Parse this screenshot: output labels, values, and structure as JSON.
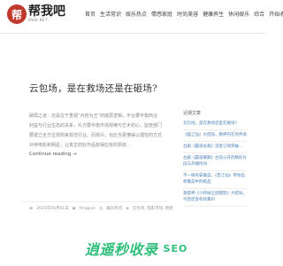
{
  "header": {
    "logo_mark": "帮",
    "logo_name": "帮我吧",
    "logo_domain": "BWB.NET",
    "nav": [
      "首页",
      "生活常识",
      "娱乐热点",
      "情感家庭",
      "时尚美容",
      "健康养生",
      "休闲娱乐",
      "综合",
      "开始收藏"
    ]
  },
  "post": {
    "title": "云包场，是在救场还是在砸场?",
    "excerpt": "破局之道：还是在于重视“内容为王”的底层逻辑，平台要平衡商业利益与行业生态的关系，片方要平衡市场规律与艺术初心，监管部门要建立全方位规则来规范行业。而观众，也应当更懂得以理性的方式对待电影和明星，让真正的好作品获得应有的票房…",
    "continue_label": "Continue reading →",
    "meta": {
      "date": "2025年06月01日",
      "author": "fengyun",
      "category": "娱乐热点",
      "tags": "云包场, 电影市场, 明星"
    }
  },
  "sidebar": {
    "heading": "近期文章",
    "items": [
      "云包场，是在救场还是在砸场?",
      "《临江仙》大结局，精神内在的传承",
      "台剧《霸道总裁》首批订阅突破…",
      "台剧《霸道卿卿》台前公开的精彩片段与开播时间",
      "不一样的安徽菜，《百江仙》带你品尝徽菜中的极品",
      "敦煌神《小师妹之团圆饭》大结局，今后还会有续集吗"
    ]
  },
  "watermark": {
    "text": "逍遥秒收录",
    "sub": "SEO"
  }
}
